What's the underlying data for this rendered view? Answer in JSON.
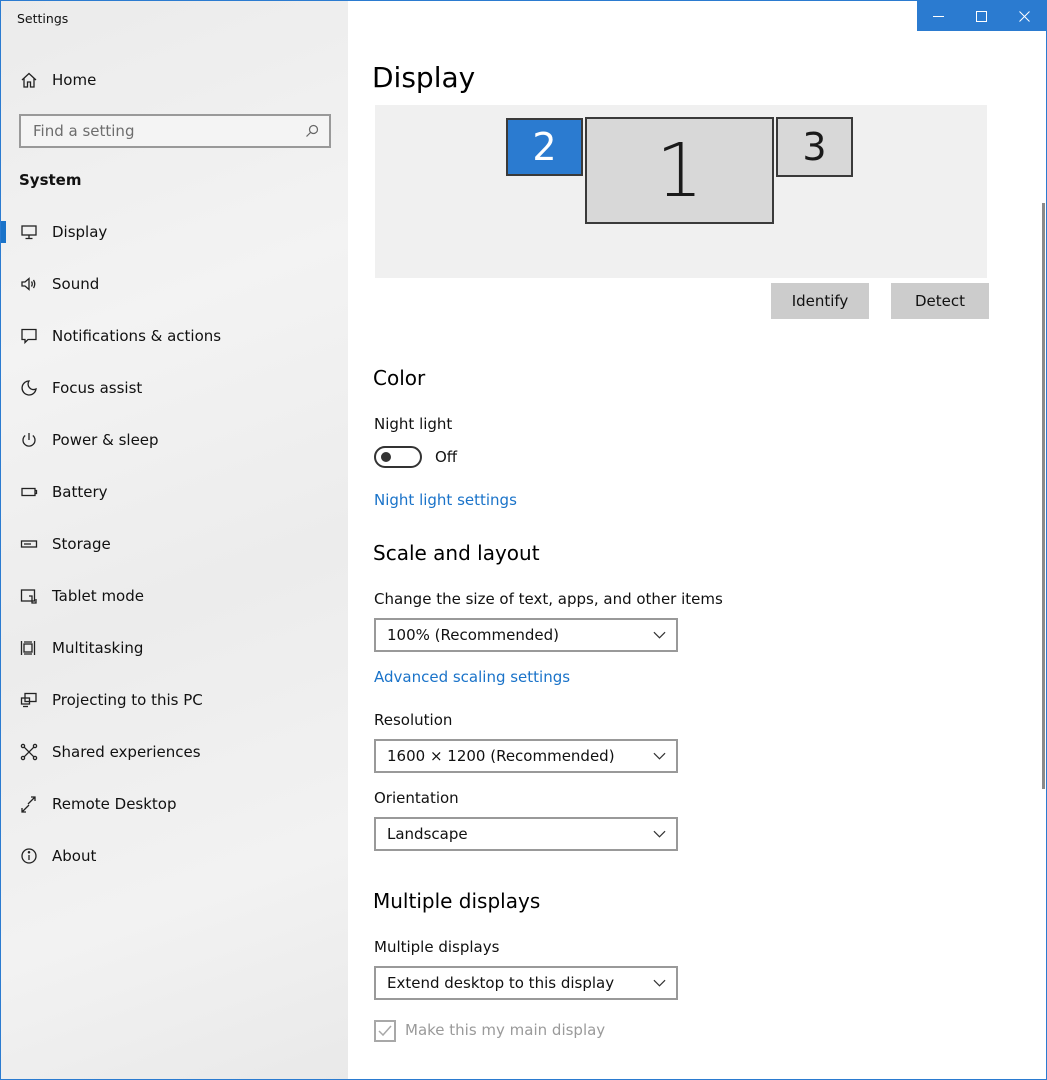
{
  "window": {
    "title": "Settings"
  },
  "sidebar": {
    "home_label": "Home",
    "search_placeholder": "Find a setting",
    "group_label": "System",
    "items": [
      {
        "label": "Display",
        "icon": "monitor-icon",
        "selected": true
      },
      {
        "label": "Sound",
        "icon": "speaker-icon"
      },
      {
        "label": "Notifications & actions",
        "icon": "speech-bubble-icon"
      },
      {
        "label": "Focus assist",
        "icon": "moon-icon"
      },
      {
        "label": "Power & sleep",
        "icon": "power-icon"
      },
      {
        "label": "Battery",
        "icon": "battery-icon"
      },
      {
        "label": "Storage",
        "icon": "storage-drive-icon"
      },
      {
        "label": "Tablet mode",
        "icon": "tablet-icon"
      },
      {
        "label": "Multitasking",
        "icon": "multitasking-icon"
      },
      {
        "label": "Projecting to this PC",
        "icon": "projecting-icon"
      },
      {
        "label": "Shared experiences",
        "icon": "shared-experiences-icon"
      },
      {
        "label": "Remote Desktop",
        "icon": "remote-desktop-icon"
      },
      {
        "label": "About",
        "icon": "info-icon"
      }
    ]
  },
  "main": {
    "title": "Display",
    "monitors": [
      "2",
      "1",
      "3"
    ],
    "identify_label": "Identify",
    "detect_label": "Detect",
    "color": {
      "title": "Color",
      "night_light_label": "Night light",
      "night_light_state": "Off",
      "night_light_settings_link": "Night light settings"
    },
    "scale": {
      "title": "Scale and layout",
      "size_label": "Change the size of text, apps, and other items",
      "size_value": "100% (Recommended)",
      "advanced_link": "Advanced scaling settings",
      "resolution_label": "Resolution",
      "resolution_value": "1600 × 1200 (Recommended)",
      "orientation_label": "Orientation",
      "orientation_value": "Landscape"
    },
    "multiple": {
      "title": "Multiple displays",
      "label": "Multiple displays",
      "value": "Extend desktop to this display",
      "main_display_label": "Make this my main display",
      "main_display_checked": true
    }
  },
  "colors": {
    "accent": "#2b7bd0",
    "link": "#1a73c9"
  }
}
